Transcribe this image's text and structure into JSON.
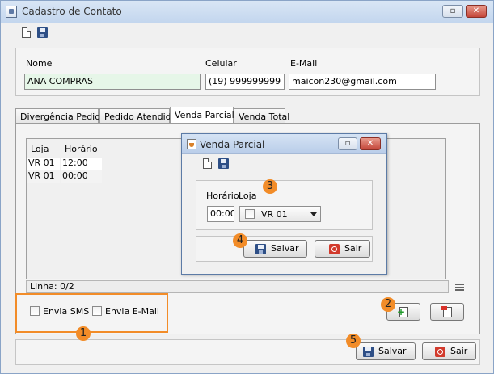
{
  "window": {
    "title": "Cadastro de Contato"
  },
  "fields": {
    "nome_label": "Nome",
    "nome_value": "ANA COMPRAS",
    "celular_label": "Celular",
    "celular_value": "(19) 999999999",
    "email_label": "E-Mail",
    "email_value": "maicon230@gmail.com"
  },
  "tabs": [
    {
      "label": "Divergência Pedido"
    },
    {
      "label": "Pedido Atendido"
    },
    {
      "label": "Venda Parcial",
      "active": true
    },
    {
      "label": "Venda Total"
    }
  ],
  "table": {
    "columns": [
      "Loja",
      "Horário"
    ],
    "rows": [
      [
        "VR 01",
        "12:00"
      ],
      [
        "VR 01",
        "00:00"
      ]
    ]
  },
  "status": {
    "linha": "Linha: 0/2"
  },
  "checkboxes": {
    "sms": "Envia SMS",
    "email": "Envia E-Mail"
  },
  "buttons": {
    "salvar": "Salvar",
    "sair": "Sair"
  },
  "dialog": {
    "title": "Venda Parcial",
    "horario_label": "Horário",
    "loja_label": "Loja",
    "horario_value": "00:00",
    "loja_value": "VR 01",
    "salvar": "Salvar",
    "sair": "Sair"
  },
  "annotations": [
    "1",
    "2",
    "3",
    "4",
    "5"
  ],
  "colors": {
    "annotation": "#f28c28",
    "titlebar": "#c3d6ee",
    "sair_icon": "#d23a2c"
  }
}
